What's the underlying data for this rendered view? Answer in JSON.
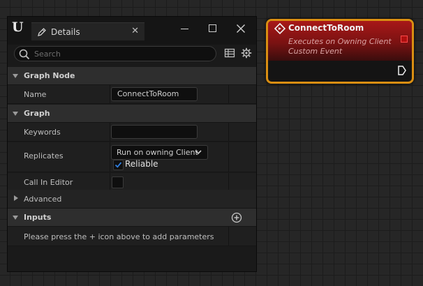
{
  "details_panel": {
    "tab_label": "Details",
    "search_placeholder": "Search",
    "sections": {
      "graph_node": {
        "label": "Graph Node",
        "name_label": "Name",
        "name_value": "ConnectToRoom"
      },
      "graph": {
        "label": "Graph",
        "keywords_label": "Keywords",
        "keywords_value": "",
        "replicates_label": "Replicates",
        "replicates_value": "Run on owning Client",
        "reliable_label": "Reliable",
        "reliable_checked": true,
        "call_in_editor_label": "Call In Editor",
        "call_in_editor_checked": false
      },
      "advanced": {
        "label": "Advanced"
      },
      "inputs": {
        "label": "Inputs",
        "hint": "Please press the + icon above to add parameters"
      }
    }
  },
  "node": {
    "title": "ConnectToRoom",
    "subtitle_line1": "Executes on Owning Client",
    "subtitle_line2": "Custom Event"
  },
  "colors": {
    "node_border": "#d98e12",
    "node_header": "#a81818",
    "checkbox_accent": "#2f7fe0"
  }
}
